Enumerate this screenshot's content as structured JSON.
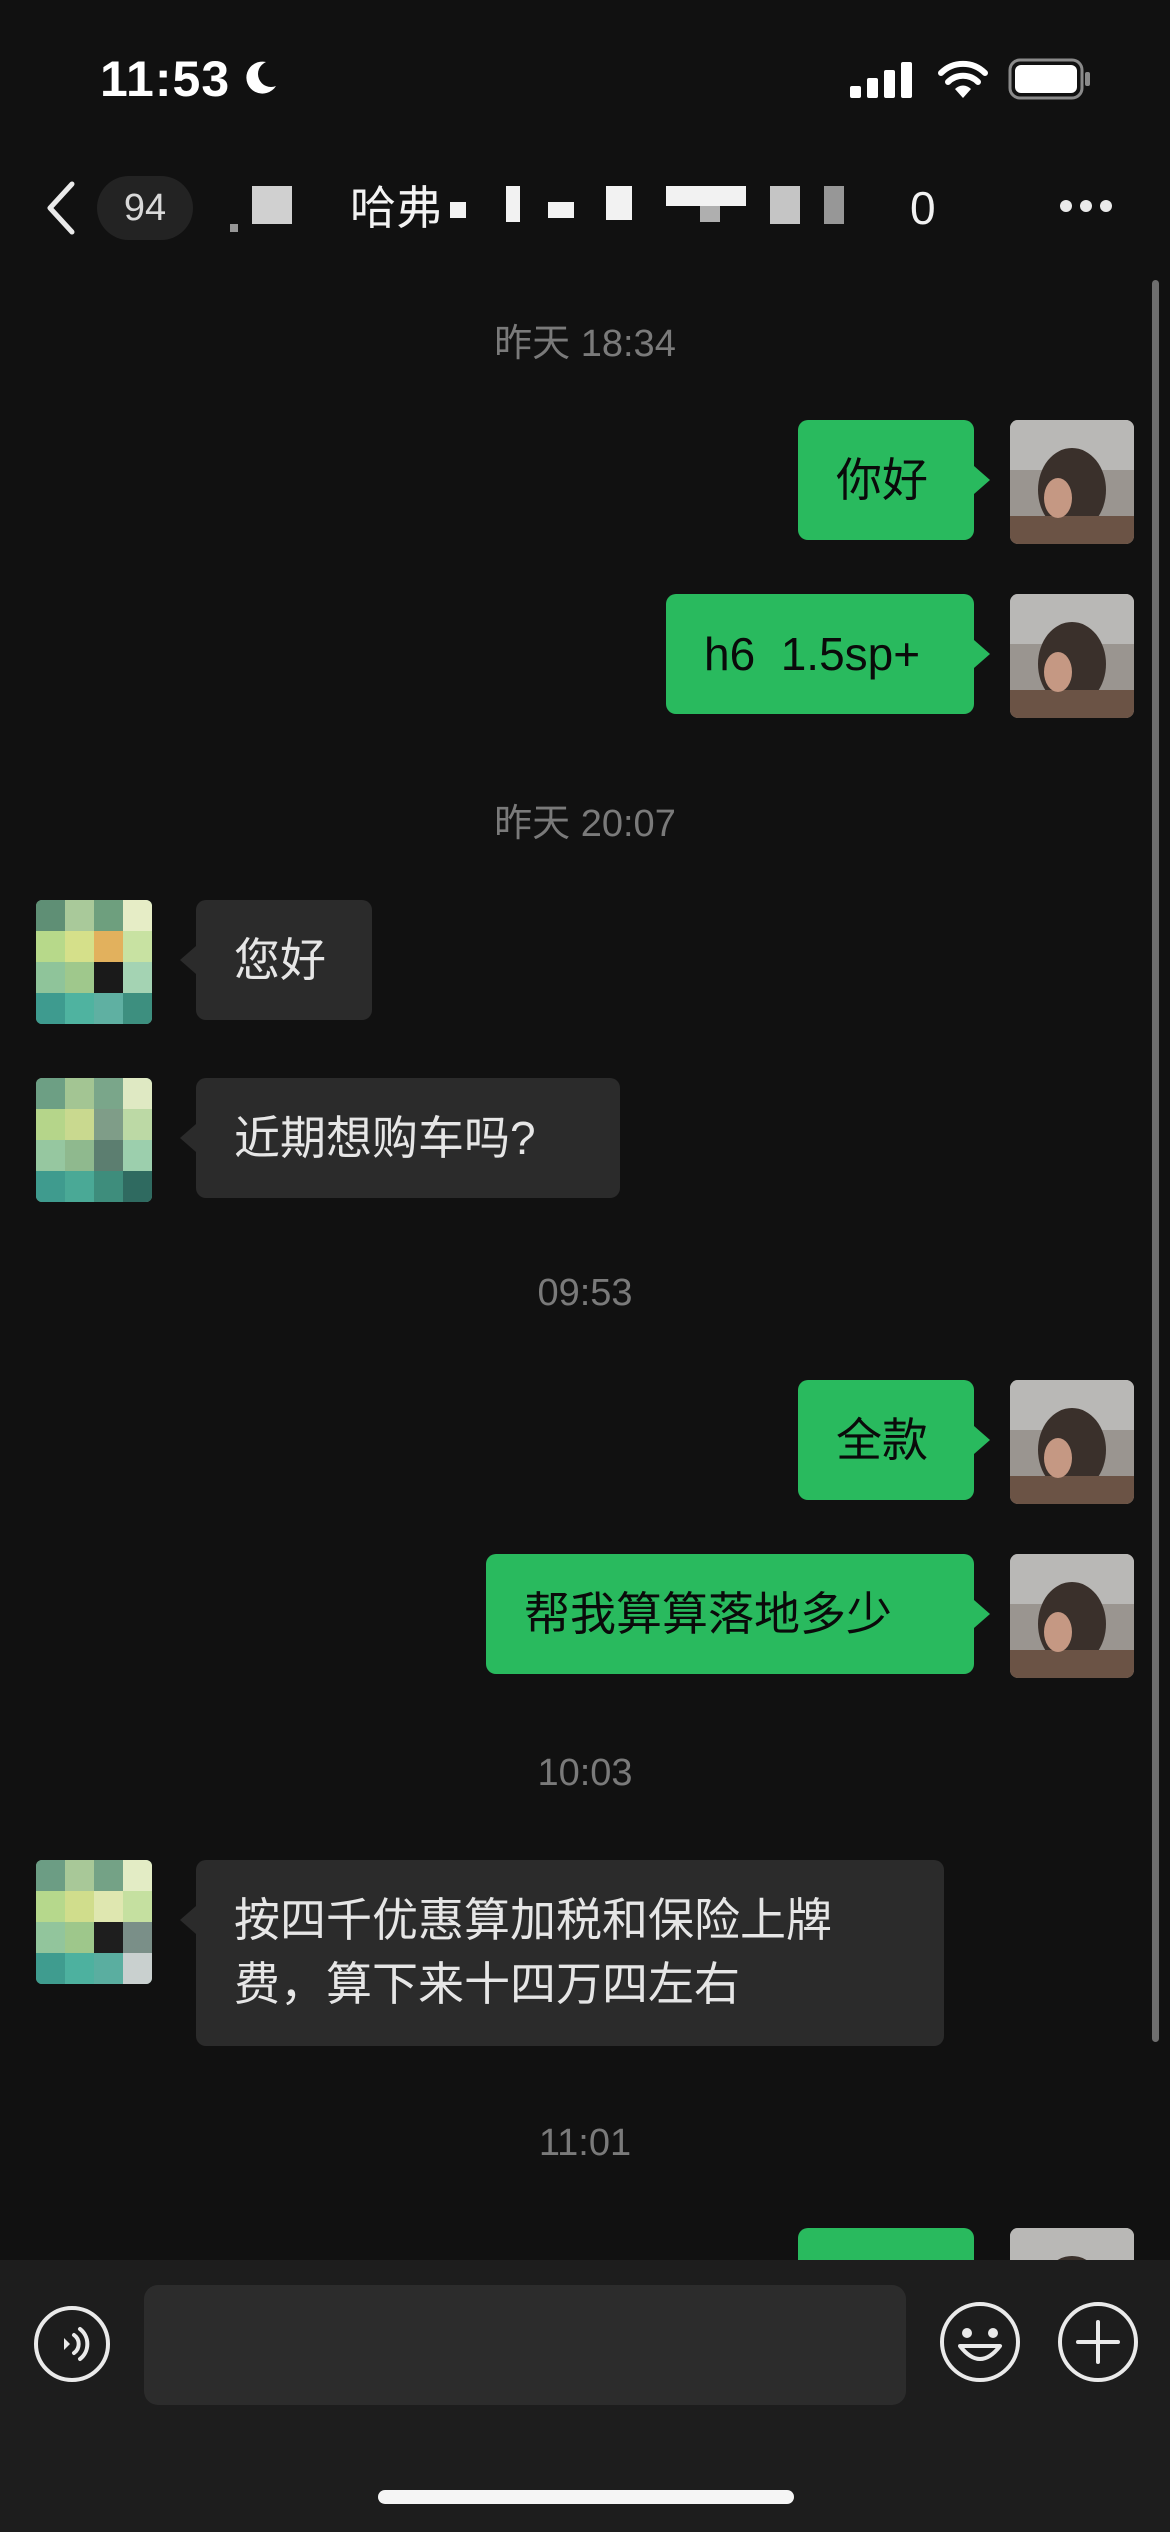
{
  "status_bar": {
    "time": "11:53"
  },
  "header": {
    "unread_count": "94",
    "title_visible": "哈弗",
    "title_tail": "0"
  },
  "messages": [
    {
      "type": "timestamp",
      "text": "昨天 18:34"
    },
    {
      "type": "outgoing",
      "text": "你好"
    },
    {
      "type": "outgoing",
      "text": "h6  1.5sp+"
    },
    {
      "type": "timestamp",
      "text": "昨天 20:07"
    },
    {
      "type": "incoming",
      "text": "您好"
    },
    {
      "type": "incoming",
      "text": "近期想购车吗?"
    },
    {
      "type": "timestamp",
      "text": "09:53"
    },
    {
      "type": "outgoing",
      "text": "全款"
    },
    {
      "type": "outgoing",
      "text": "帮我算算落地多少"
    },
    {
      "type": "timestamp",
      "text": "10:03"
    },
    {
      "type": "incoming",
      "text": "按四千优惠算加税和保险上牌费，算下来十四万四左右"
    },
    {
      "type": "timestamp",
      "text": "11:01"
    },
    {
      "type": "outgoing",
      "text": ""
    }
  ],
  "input_bar": {
    "placeholder": ""
  },
  "colors": {
    "background": "#111111",
    "outgoing_bubble": "#29ba5e",
    "incoming_bubble": "#2b2b2b",
    "input_bar": "#1d1d1d"
  },
  "icons": [
    "moon-icon",
    "signal-icon",
    "wifi-icon",
    "battery-icon",
    "back-icon",
    "more-icon",
    "voice-icon",
    "emoji-icon",
    "plus-icon"
  ]
}
